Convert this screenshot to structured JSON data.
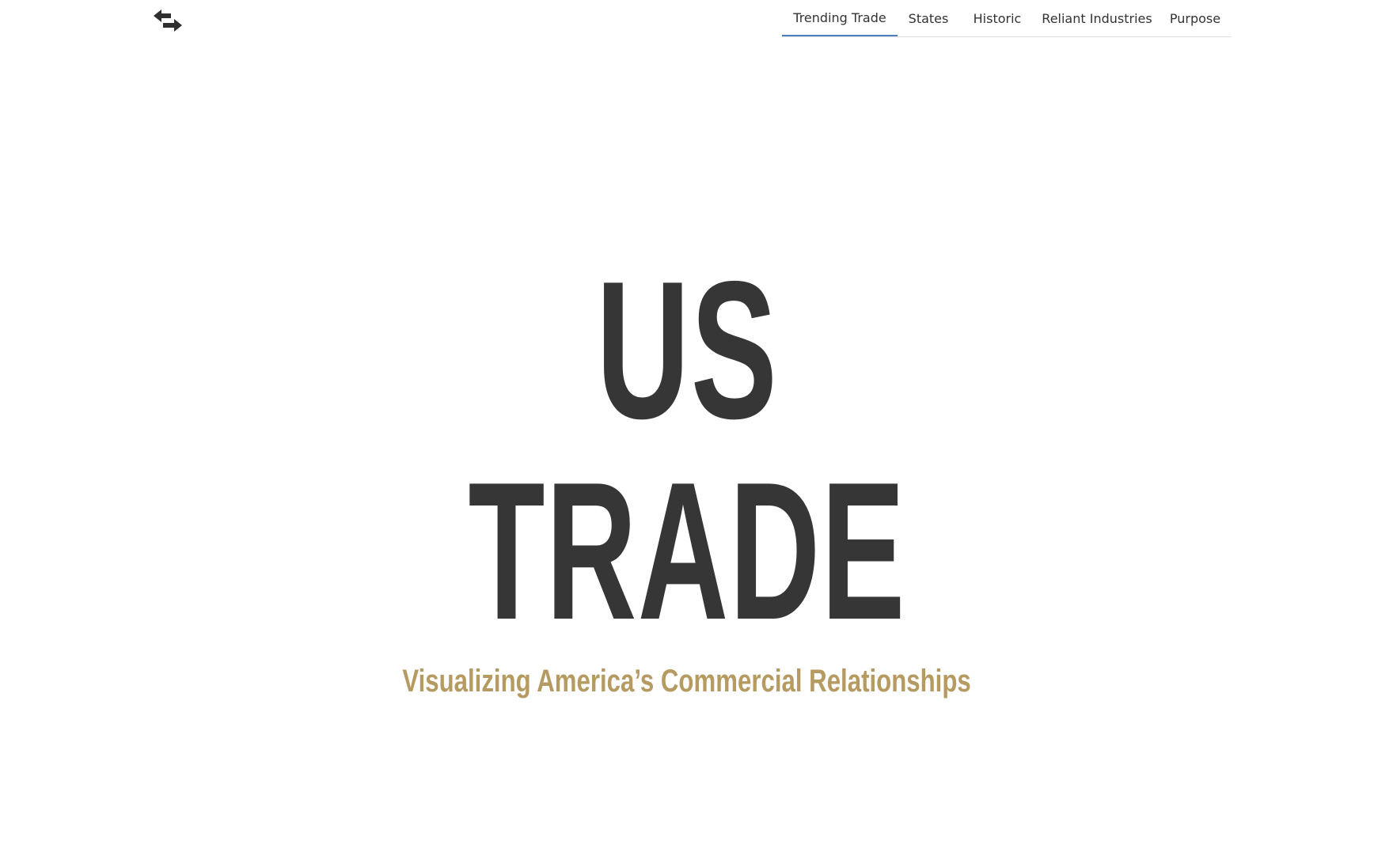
{
  "header": {
    "logo_icon": "swap-arrows-icon",
    "nav": [
      {
        "label": "Trending Trade",
        "active": true
      },
      {
        "label": "States",
        "active": false
      },
      {
        "label": "Historic",
        "active": false
      },
      {
        "label": "Reliant Industries",
        "active": false
      },
      {
        "label": "Purpose",
        "active": false
      }
    ]
  },
  "hero": {
    "title_line_1": "US",
    "title_line_2": "TRADE",
    "subtitle": "Visualizing America’s Commercial Relationships"
  },
  "colors": {
    "title": "#363636",
    "subtitle": "#b59a61",
    "active_tab_underline": "#4a7fc1"
  }
}
